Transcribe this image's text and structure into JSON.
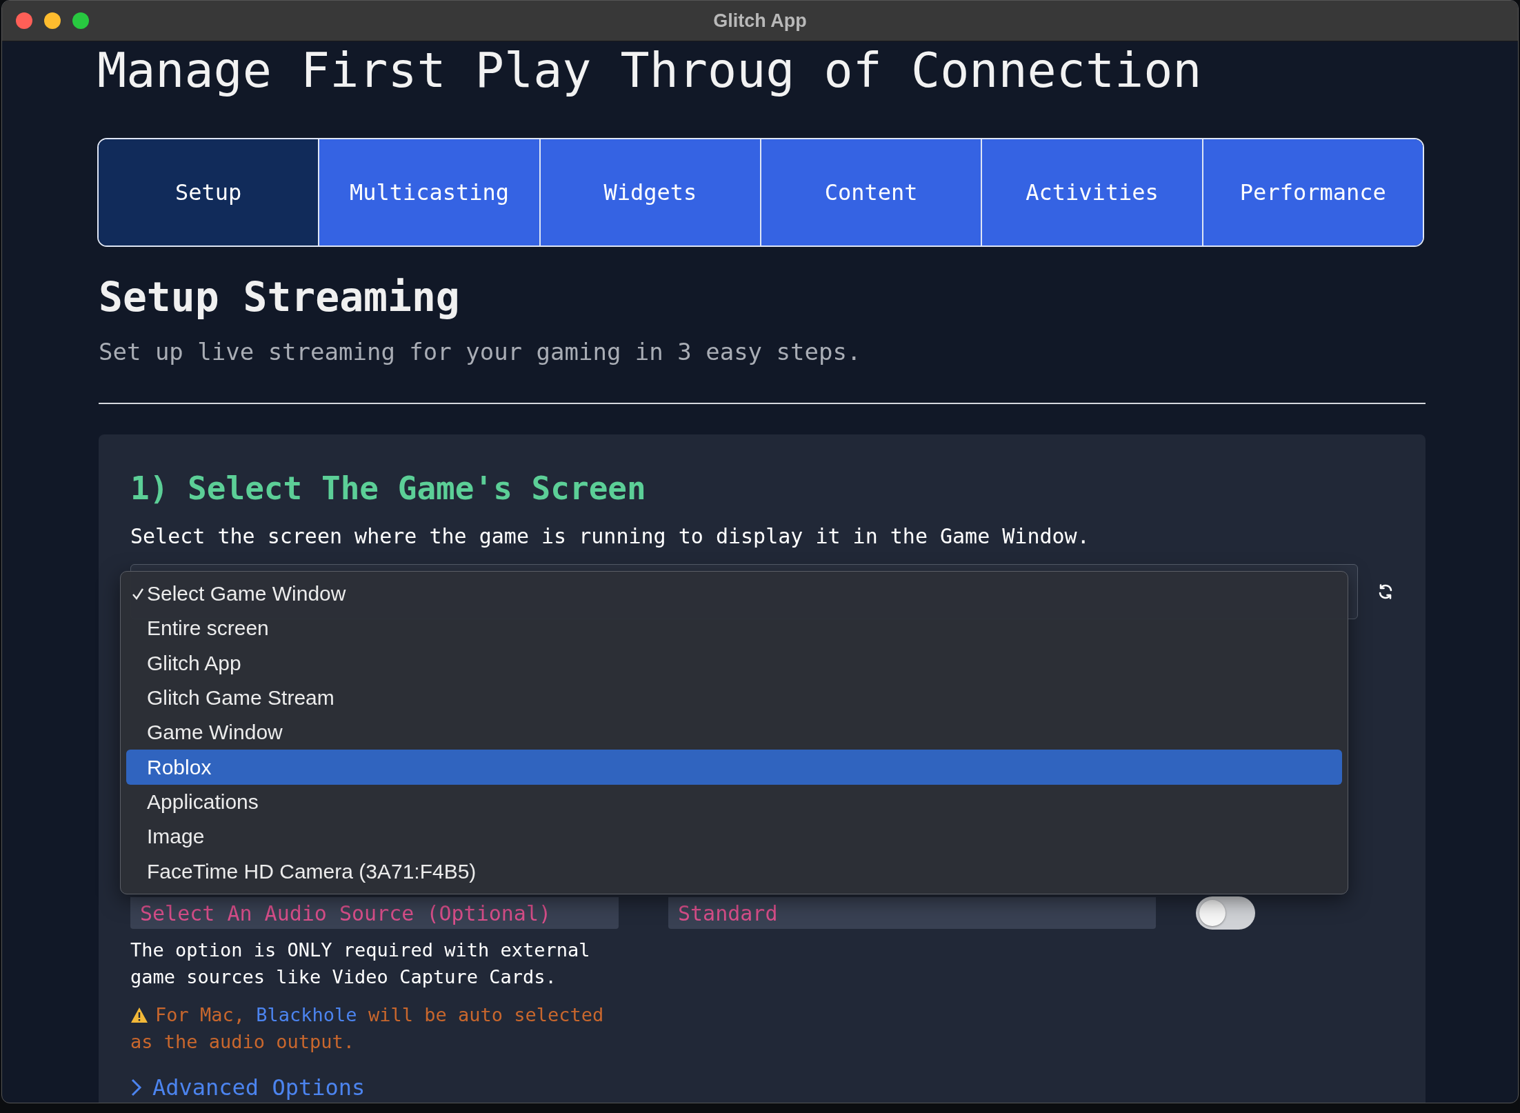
{
  "window": {
    "title": "Glitch App"
  },
  "page_title": "Manage First Play Throug of Connection",
  "tabs": [
    {
      "label": "Setup",
      "selected": true
    },
    {
      "label": "Multicasting",
      "selected": false
    },
    {
      "label": "Widgets",
      "selected": false
    },
    {
      "label": "Content",
      "selected": false
    },
    {
      "label": "Activities",
      "selected": false
    },
    {
      "label": "Performance",
      "selected": false
    }
  ],
  "section": {
    "title": "Setup Streaming",
    "subtitle": "Set up live streaming for your gaming in 3 easy steps."
  },
  "step": {
    "title": "1) Select The Game's Screen",
    "description": "Select the screen where the game is running to display it in the Game Window.",
    "screen_menu": [
      {
        "label": "Select Game Window",
        "checked": true,
        "selected": false
      },
      {
        "label": "Entire screen",
        "checked": false,
        "selected": false
      },
      {
        "label": "Glitch App",
        "checked": false,
        "selected": false
      },
      {
        "label": "Glitch Game Stream",
        "checked": false,
        "selected": false
      },
      {
        "label": "Game Window",
        "checked": false,
        "selected": false
      },
      {
        "label": "Roblox",
        "checked": false,
        "selected": true
      },
      {
        "label": "Applications",
        "checked": false,
        "selected": false
      },
      {
        "label": "Image",
        "checked": false,
        "selected": false
      },
      {
        "label": "FaceTime HD Camera (3A71:F4B5)",
        "checked": false,
        "selected": false
      }
    ]
  },
  "audio": {
    "source_field": {
      "placeholder": "Select An Audio Source (Optional)"
    },
    "quality_field": {
      "placeholder": "Standard"
    },
    "toggle": {
      "on": false
    },
    "help": "The option is ONLY required with external game sources like Video Capture Cards.",
    "warning": {
      "before": "For Mac,",
      "link": "Blackhole",
      "after": "will be auto selected as the audio output."
    }
  },
  "advanced_options": {
    "label": "Advanced Options",
    "expanded": false
  }
}
